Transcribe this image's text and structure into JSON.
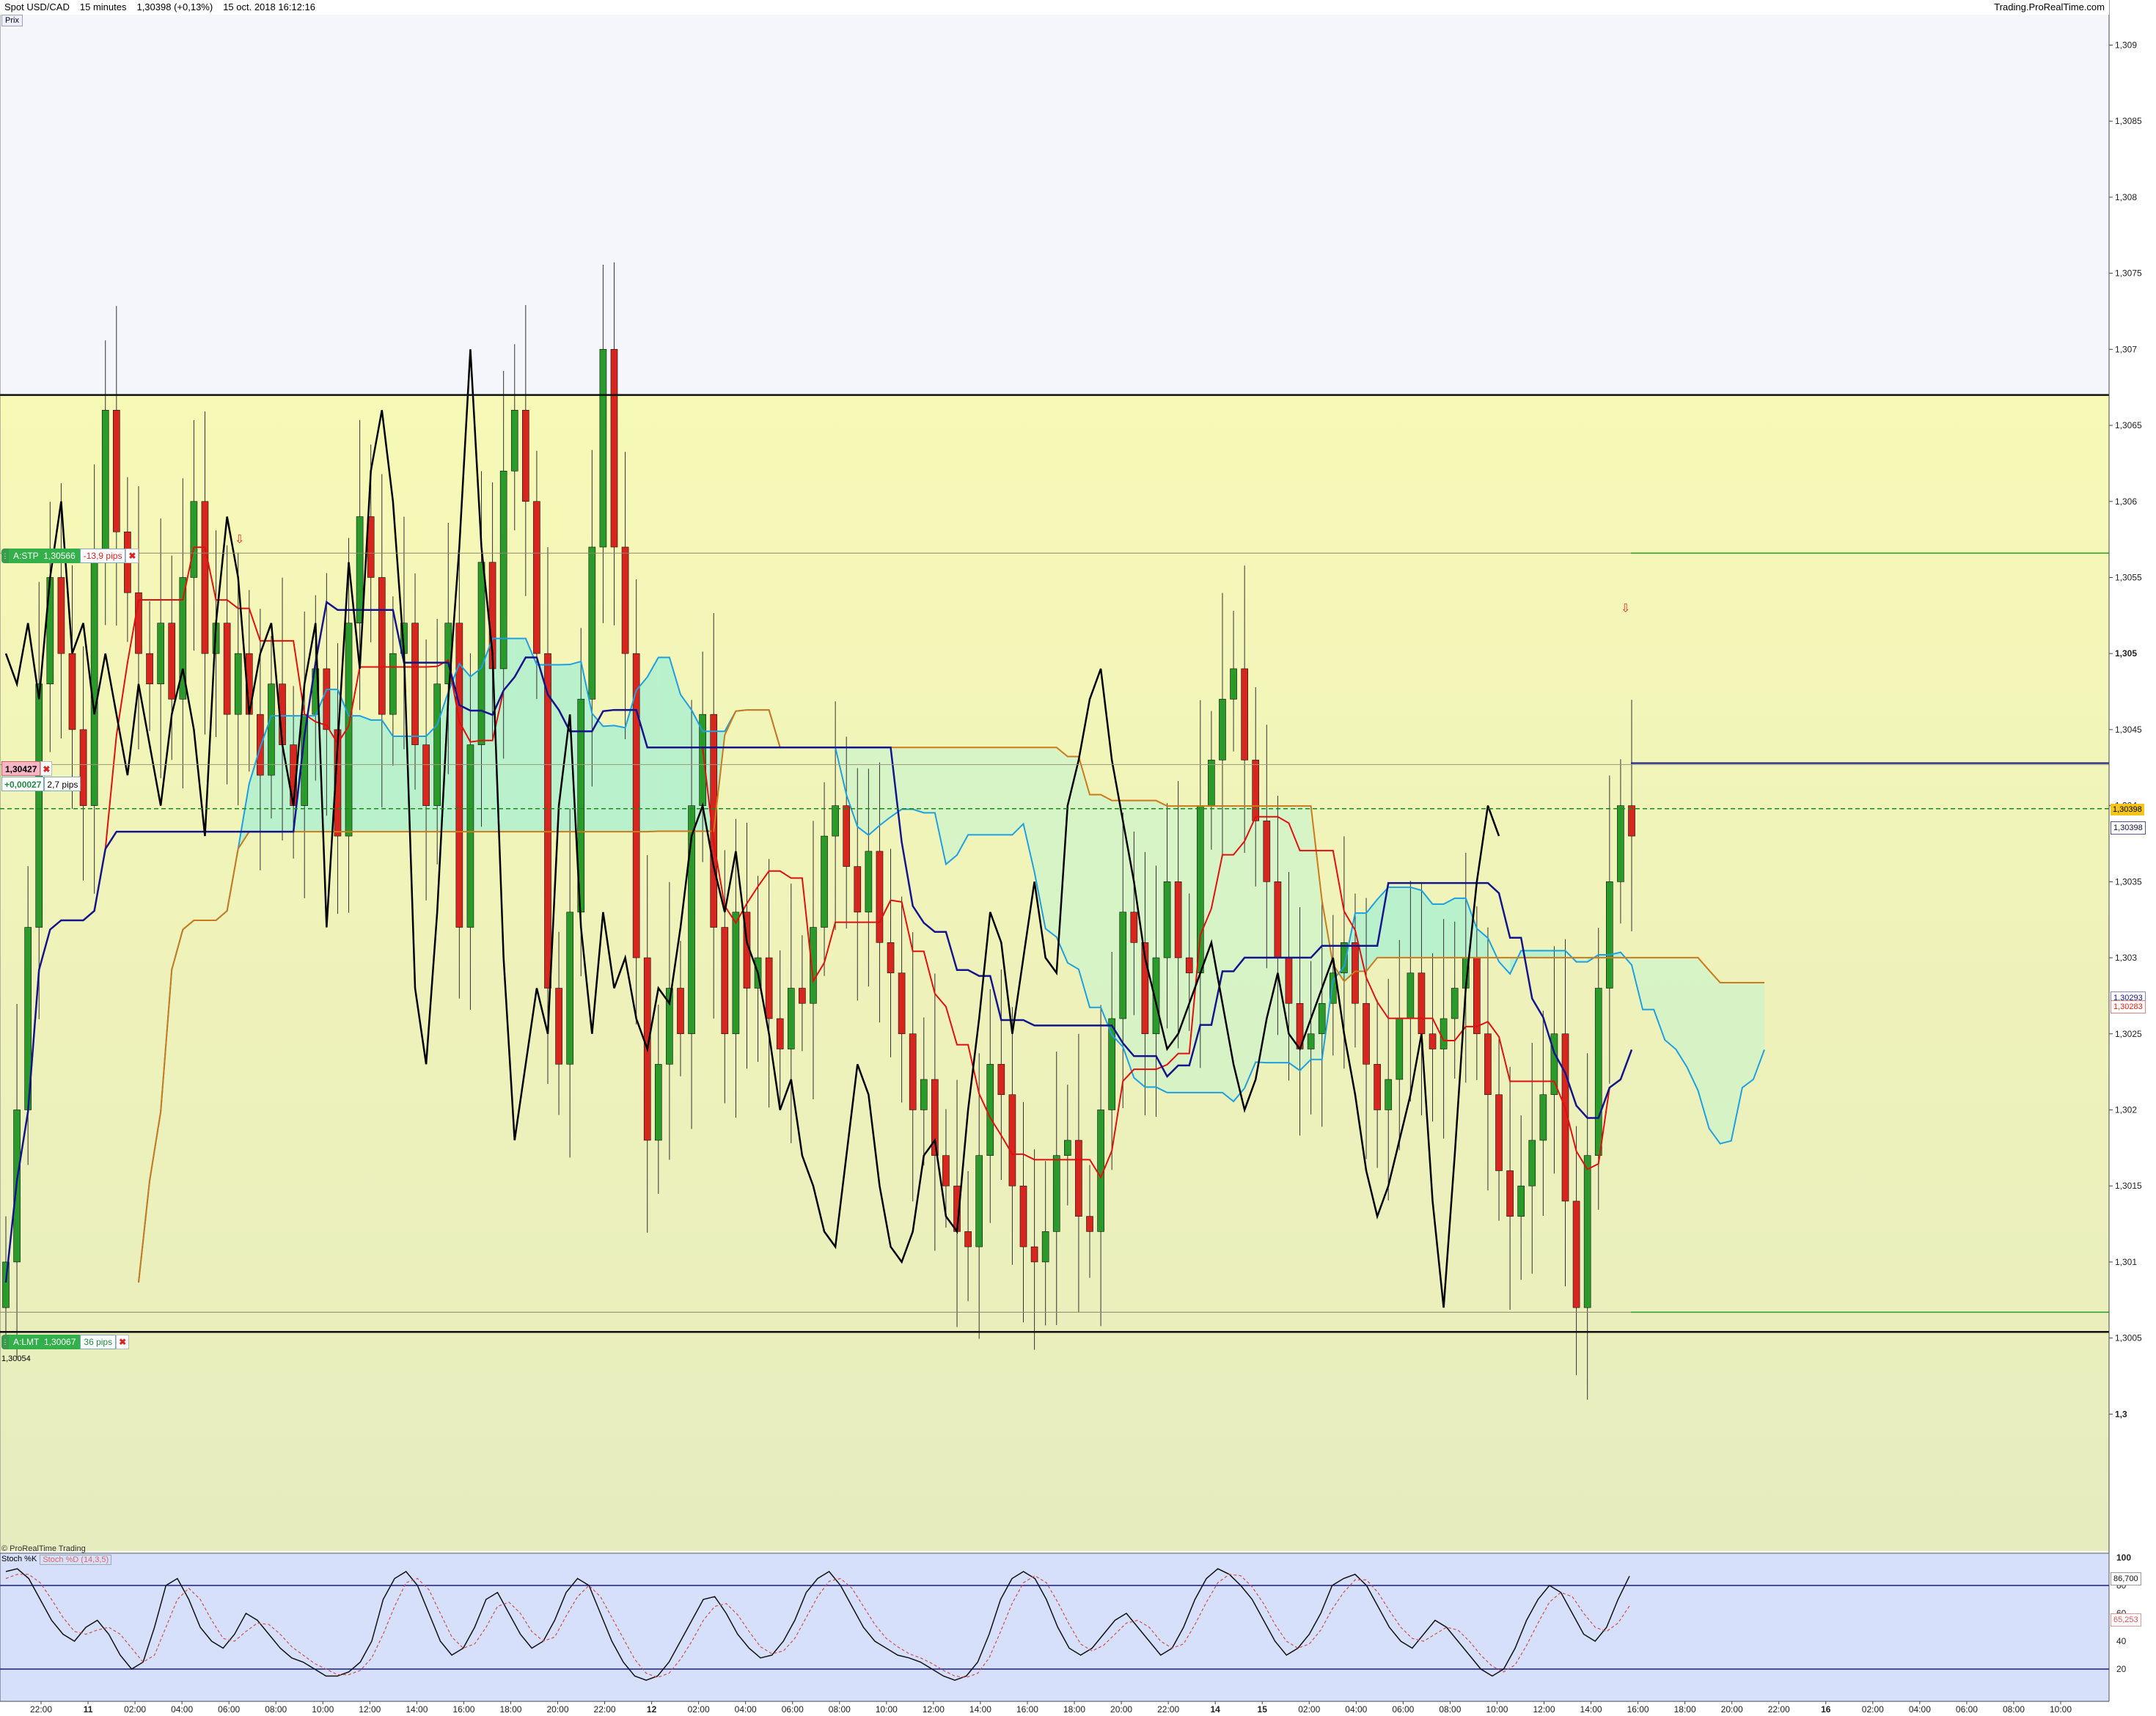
{
  "header": {
    "instrument": "Spot USD/CAD",
    "timeframe": "15 minutes",
    "last": "1,30398 (+0,13%)",
    "datetime": "15 oct. 2018 16:12:16",
    "brand": "Trading.ProRealTime.com",
    "tab": "Prix"
  },
  "orders": {
    "stop_label": "A:STP",
    "stop_price": "1,30566",
    "stop_pips": "-13,9 pips",
    "limit_label": "A:LMT",
    "limit_price": "1,30067",
    "limit_pips": "36 pips",
    "position_price": "1,30427",
    "position_pnl": "+0,00027",
    "position_pips": "2,7 pips",
    "level_label": "1,30054"
  },
  "price_tags": {
    "last": "1,30398",
    "bid": "1,30398",
    "ind1": "1,30293",
    "ind2": "1,30283"
  },
  "indicator": {
    "source": "© ProRealTime Trading",
    "name": "Stoch %K",
    "signal": "Stoch %D (14,3,5)",
    "k_value": "86,700",
    "d_value": "65,253"
  },
  "colors": {
    "zone_bg": "#f5f7b8",
    "upper_bg": "#f4f6fb",
    "cloud_green": "#aef0cf",
    "candle_up": "#2a9a2a",
    "candle_down": "#d7261e",
    "tenkan": "#e01010",
    "kijun": "#14148c",
    "chikou": "#000000",
    "span_a": "#1ea0e0",
    "span_b": "#cc7a1a",
    "stoch_bg": "#d6e0fb"
  },
  "chart_data": [
    {
      "type": "line",
      "series_kind": "candlestick with ichimoku",
      "y_axis_labels": [
        "1,309",
        "1,3085",
        "1,308",
        "1,3075",
        "1,307",
        "1,3065",
        "1,306",
        "1,3055",
        "1,305",
        "1,3045",
        "1,304",
        "1,3035",
        "1,303",
        "1,3025",
        "1,302",
        "1,3015",
        "1,301",
        "1,3005",
        "1,3"
      ],
      "ylim": [
        1.2991,
        1.3092
      ],
      "x_axis_labels": [
        "22:00",
        "11",
        "02:00",
        "04:00",
        "06:00",
        "08:00",
        "10:00",
        "12:00",
        "14:00",
        "16:00",
        "18:00",
        "20:00",
        "22:00",
        "12",
        "02:00",
        "04:00",
        "06:00",
        "08:00",
        "10:00",
        "12:00",
        "14:00",
        "16:00",
        "18:00",
        "20:00",
        "22:00",
        "14",
        "15",
        "02:00",
        "04:00",
        "06:00",
        "08:00",
        "10:00",
        "12:00",
        "14:00",
        "16:00",
        "18:00",
        "20:00",
        "22:00",
        "16",
        "02:00",
        "04:00",
        "06:00",
        "08:00",
        "10:00"
      ],
      "levels": {
        "stop": 1.30566,
        "limit": 1.30067,
        "position": 1.30427,
        "last": 1.30398,
        "zone_top": 1.3067,
        "zone_bottom": 1.30054
      },
      "close_path": [
        1.301,
        1.302,
        1.3032,
        1.3048,
        1.3055,
        1.305,
        1.3045,
        1.304,
        1.3056,
        1.3066,
        1.3058,
        1.3054,
        1.305,
        1.3048,
        1.3052,
        1.3047,
        1.3055,
        1.306,
        1.305,
        1.3052,
        1.3046,
        1.305,
        1.3046,
        1.3042,
        1.3048,
        1.3044,
        1.304,
        1.3046,
        1.3049,
        1.3045,
        1.3038,
        1.3052,
        1.3059,
        1.3055,
        1.3046,
        1.305,
        1.3052,
        1.3044,
        1.304,
        1.3048,
        1.3052,
        1.3032,
        1.3044,
        1.3056,
        1.3049,
        1.3062,
        1.3066,
        1.306,
        1.305,
        1.3028,
        1.3023,
        1.3033,
        1.3047,
        1.3057,
        1.307,
        1.3057,
        1.305,
        1.303,
        1.3018,
        1.3023,
        1.3028,
        1.3025,
        1.304,
        1.3046,
        1.3032,
        1.3025,
        1.3033,
        1.3028,
        1.303,
        1.3026,
        1.3024,
        1.3028,
        1.3027,
        1.3032,
        1.3038,
        1.304,
        1.3036,
        1.3033,
        1.3037,
        1.3031,
        1.3029,
        1.3025,
        1.302,
        1.3022,
        1.3017,
        1.3015,
        1.3012,
        1.3011,
        1.3017,
        1.3023,
        1.3021,
        1.3015,
        1.3011,
        1.301,
        1.3012,
        1.3017,
        1.3018,
        1.3013,
        1.3012,
        1.302,
        1.3026,
        1.3033,
        1.3031,
        1.3025,
        1.303,
        1.3035,
        1.303,
        1.3029,
        1.304,
        1.3043,
        1.3047,
        1.3049,
        1.3043,
        1.3039,
        1.3035,
        1.303,
        1.3027,
        1.3024,
        1.3025,
        1.3027,
        1.3029,
        1.3031,
        1.3027,
        1.3023,
        1.302,
        1.3022,
        1.3026,
        1.3029,
        1.3025,
        1.3024,
        1.3026,
        1.3028,
        1.303,
        1.3025,
        1.3021,
        1.3016,
        1.3013,
        1.3015,
        1.3018,
        1.3021,
        1.3025,
        1.3014,
        1.3007,
        1.3017,
        1.3028,
        1.3035,
        1.304,
        1.3038
      ]
    },
    {
      "type": "line",
      "name": "Stoch %K",
      "y_axis_labels": [
        "100",
        "80",
        "60",
        "40",
        "20"
      ],
      "ylim": [
        0,
        100
      ],
      "levels": [
        80,
        20
      ],
      "k_values": [
        90,
        92,
        85,
        70,
        55,
        45,
        40,
        50,
        55,
        45,
        30,
        20,
        25,
        50,
        80,
        85,
        70,
        50,
        40,
        35,
        45,
        60,
        55,
        45,
        35,
        28,
        25,
        20,
        15,
        15,
        18,
        25,
        40,
        70,
        85,
        90,
        80,
        60,
        40,
        30,
        35,
        50,
        70,
        75,
        60,
        45,
        35,
        40,
        55,
        75,
        85,
        80,
        60,
        40,
        25,
        15,
        12,
        15,
        25,
        40,
        55,
        70,
        72,
        60,
        45,
        35,
        28,
        30,
        40,
        55,
        75,
        85,
        90,
        80,
        65,
        50,
        40,
        35,
        30,
        28,
        25,
        20,
        15,
        12,
        15,
        25,
        45,
        70,
        85,
        90,
        85,
        70,
        50,
        35,
        30,
        35,
        45,
        55,
        60,
        50,
        40,
        30,
        35,
        50,
        70,
        85,
        92,
        88,
        80,
        70,
        55,
        40,
        30,
        35,
        45,
        60,
        80,
        85,
        88,
        80,
        65,
        50,
        40,
        35,
        45,
        55,
        50,
        40,
        30,
        20,
        15,
        20,
        35,
        55,
        70,
        80,
        75,
        60,
        45,
        40,
        50,
        70,
        86.7
      ],
      "d_values": [
        85,
        88,
        88,
        82,
        70,
        57,
        47,
        45,
        48,
        50,
        45,
        35,
        25,
        30,
        50,
        70,
        78,
        70,
        55,
        42,
        40,
        47,
        53,
        52,
        45,
        36,
        30,
        24,
        20,
        16,
        16,
        19,
        28,
        45,
        65,
        82,
        85,
        77,
        60,
        43,
        35,
        38,
        50,
        65,
        68,
        60,
        47,
        40,
        43,
        58,
        72,
        80,
        72,
        57,
        42,
        27,
        17,
        14,
        17,
        27,
        40,
        55,
        65,
        67,
        59,
        47,
        36,
        31,
        33,
        42,
        57,
        72,
        83,
        85,
        78,
        65,
        52,
        42,
        36,
        31,
        28,
        24,
        19,
        15,
        14,
        17,
        28,
        47,
        67,
        82,
        87,
        82,
        68,
        52,
        38,
        33,
        37,
        45,
        53,
        55,
        50,
        40,
        35,
        38,
        52,
        68,
        82,
        88,
        87,
        79,
        67,
        52,
        40,
        35,
        38,
        48,
        63,
        75,
        84,
        84,
        75,
        62,
        50,
        42,
        40,
        45,
        50,
        48,
        40,
        30,
        22,
        18,
        23,
        37,
        53,
        68,
        75,
        72,
        60,
        50,
        47,
        53,
        65.3
      ]
    }
  ]
}
